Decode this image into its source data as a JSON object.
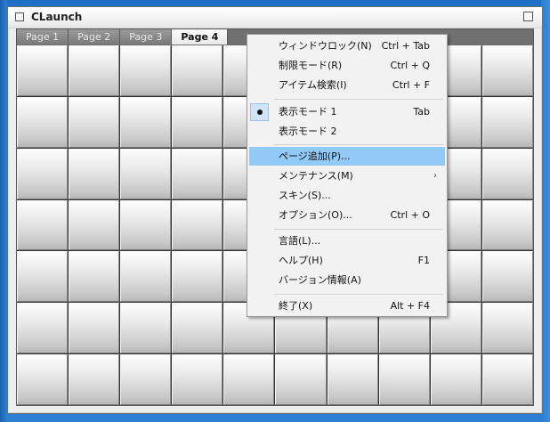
{
  "window": {
    "title": "CLaunch"
  },
  "tabs": [
    {
      "label": "Page 1",
      "active": false
    },
    {
      "label": "Page 2",
      "active": false
    },
    {
      "label": "Page 3",
      "active": false
    },
    {
      "label": "Page 4",
      "active": true
    }
  ],
  "grid": {
    "columns": 10,
    "rows": 7
  },
  "menu": {
    "items": [
      {
        "label": "ウィンドウロック(N)",
        "shortcut": "Ctrl + Tab"
      },
      {
        "label": "制限モード(R)",
        "shortcut": "Ctrl + Q"
      },
      {
        "label": "アイテム検索(I)",
        "shortcut": "Ctrl + F"
      },
      {
        "label": "表示モード 1",
        "shortcut": "Tab",
        "checked": true
      },
      {
        "label": "表示モード 2",
        "shortcut": ""
      },
      {
        "label": "ページ追加(P)...",
        "shortcut": "",
        "highlighted": true
      },
      {
        "label": "メンテナンス(M)",
        "shortcut": "",
        "submenu": true
      },
      {
        "label": "スキン(S)...",
        "shortcut": ""
      },
      {
        "label": "オプション(O)...",
        "shortcut": "Ctrl + O"
      },
      {
        "label": "言語(L)...",
        "shortcut": ""
      },
      {
        "label": "ヘルプ(H)",
        "shortcut": "F1"
      },
      {
        "label": "バージョン情報(A)",
        "shortcut": ""
      },
      {
        "label": "終了(X)",
        "shortcut": "Alt + F4"
      }
    ],
    "submenu_glyph": "›",
    "highlight_color": "#91c9f7"
  }
}
